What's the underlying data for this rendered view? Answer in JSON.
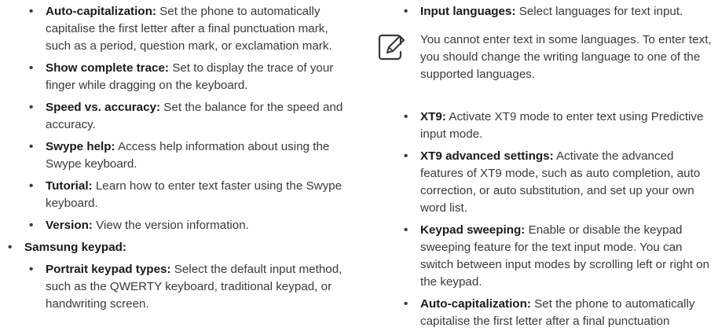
{
  "left": {
    "items_top": [
      {
        "term": "Auto-capitalization:",
        "desc": "Set the phone to automatically capitalise the first letter after a final punctuation mark, such as a period, question mark, or exclamation mark."
      },
      {
        "term": "Show complete trace:",
        "desc": "Set to display the trace of your finger while dragging on the keyboard."
      },
      {
        "term": "Speed vs. accuracy:",
        "desc": "Set the balance for the speed and accuracy."
      },
      {
        "term": "Swype help:",
        "desc": "Access help information about using the Swype keyboard."
      },
      {
        "term": "Tutorial:",
        "desc": "Learn how to enter text faster using the Swype keyboard."
      },
      {
        "term": "Version:",
        "desc": "View the version information."
      }
    ],
    "section": {
      "term": "Samsung keypad:"
    },
    "items_bottom": [
      {
        "term": "Portrait keypad types:",
        "desc": "Select the default input method, such as the QWERTY keyboard, traditional keypad, or handwriting screen."
      }
    ]
  },
  "right": {
    "items_top": [
      {
        "term": "Input languages:",
        "desc": "Select languages for text input."
      }
    ],
    "note": "You cannot enter text in some languages. To enter text, you should change the writing language to one of the supported languages.",
    "items_bottom": [
      {
        "term": "XT9:",
        "desc": "Activate XT9 mode to enter text using Predictive input mode."
      },
      {
        "term": "XT9 advanced settings:",
        "desc": "Activate the advanced features of XT9 mode, such as auto completion, auto correction, or auto substitution, and set up your own word list."
      },
      {
        "term": "Keypad sweeping:",
        "desc": "Enable or disable the keypad sweeping feature for the text input mode. You can switch between input modes by scrolling left or right on the keypad."
      },
      {
        "term": "Auto-capitalization:",
        "desc": "Set the phone to automatically capitalise the first letter after a final punctuation"
      }
    ]
  },
  "bullet_char": "•",
  "icons": {
    "note": "note-pencil-icon"
  }
}
